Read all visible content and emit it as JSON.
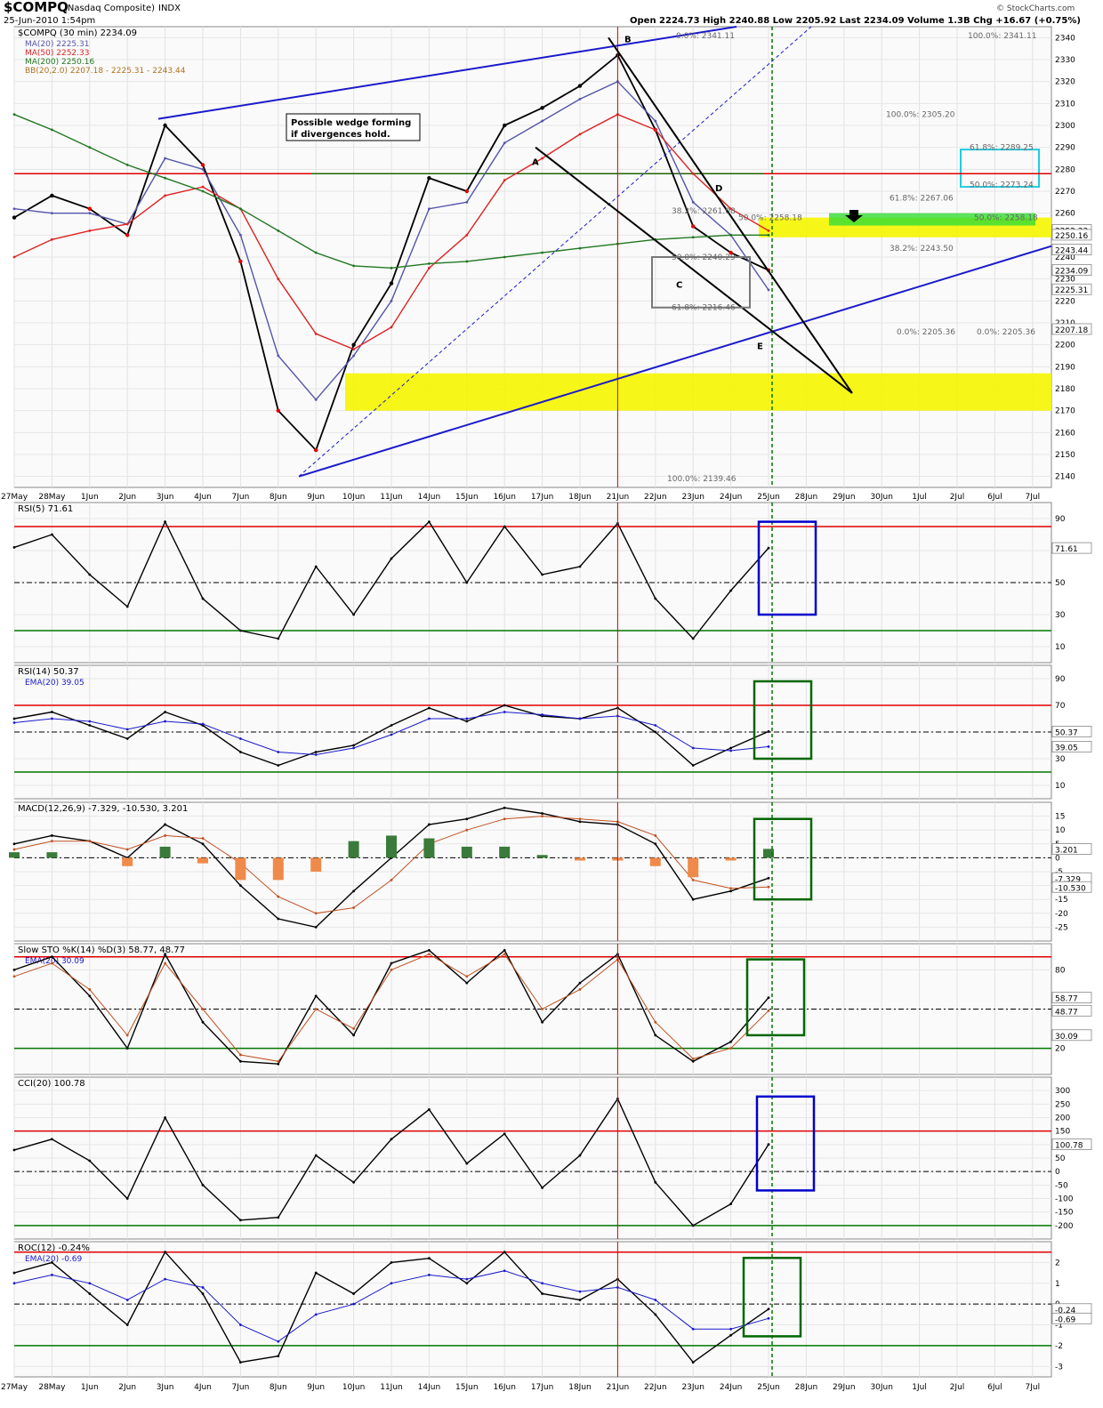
{
  "header": {
    "symbol": "$COMPQ",
    "name": "(Nasdaq Composite)",
    "exchange": "INDX",
    "date": "25-Jun-2010 1:54pm",
    "stats": "Open 2224.73  High 2240.88  Low 2205.92  Last 2234.09  Volume 1.3B  Chg +16.67 (+0.75%)",
    "brand": "© StockCharts.com"
  },
  "colors": {
    "price_up": "#000000",
    "price_down": "#e00000",
    "ma20": "#5555aa",
    "ma50": "#dd2222",
    "ma200": "#227722",
    "bb_fill": "#f3dfb8",
    "bb_line": "#c8a870",
    "rsi_over": "#3a7a3a",
    "rsi_under": "#f08a4a",
    "red_line": "#e00000",
    "green_line": "#007700",
    "blue_line": "#1a1acc",
    "yellow_zone": "#f5f500",
    "green_zone": "#33dd33",
    "cyan": "#22ccdd"
  },
  "x_axis_labels": [
    "27May",
    "28May",
    "1Jun",
    "2Jun",
    "3Jun",
    "4Jun",
    "7Jun",
    "8Jun",
    "9Jun",
    "10Jun",
    "11Jun",
    "14Jun",
    "15Jun",
    "16Jun",
    "17Jun",
    "18Jun",
    "21Jun",
    "22Jun",
    "23Jun",
    "24Jun",
    "25Jun",
    "28Jun",
    "29Jun",
    "30Jun",
    "1Jul",
    "2Jul",
    "6Jul",
    "7Jul"
  ],
  "chart_data": [
    {
      "type": "line",
      "panel": "price",
      "title": "$COMPQ (30 min) 2234.09",
      "legend": [
        "MA(20) 2225.31",
        "MA(50) 2252.33",
        "MA(200) 2250.16",
        "BB(20,2.0) 2207.18 - 2225.31 - 2243.44"
      ],
      "ylim": [
        2135,
        2345
      ],
      "yticks": [
        2140,
        2150,
        2160,
        2170,
        2180,
        2190,
        2200,
        2210,
        2220,
        2230,
        2240,
        2250,
        2260,
        2270,
        2280,
        2290,
        2300,
        2310,
        2320,
        2330,
        2340
      ],
      "value_boxes": [
        "2252.33",
        "2250.16",
        "2243.44",
        "2234.09",
        "2225.31",
        "2207.18"
      ],
      "x": [
        "27May",
        "28May",
        "1Jun",
        "2Jun",
        "3Jun",
        "4Jun",
        "7Jun",
        "8Jun",
        "9Jun",
        "10Jun",
        "11Jun",
        "14Jun",
        "15Jun",
        "16Jun",
        "17Jun",
        "18Jun",
        "21Jun",
        "22Jun",
        "23Jun",
        "24Jun",
        "25Jun"
      ],
      "series": [
        {
          "name": "$COMPQ",
          "values": [
            2258,
            2268,
            2262,
            2250,
            2300,
            2282,
            2238,
            2170,
            2152,
            2200,
            2228,
            2276,
            2270,
            2300,
            2308,
            2318,
            2332,
            2298,
            2254,
            2242,
            2234
          ]
        },
        {
          "name": "MA(20)",
          "values": [
            2262,
            2260,
            2260,
            2255,
            2285,
            2280,
            2250,
            2195,
            2175,
            2195,
            2220,
            2262,
            2265,
            2292,
            2302,
            2312,
            2320,
            2302,
            2265,
            2250,
            2225
          ]
        },
        {
          "name": "MA(50)",
          "values": [
            2240,
            2248,
            2252,
            2255,
            2268,
            2272,
            2262,
            2230,
            2205,
            2198,
            2208,
            2235,
            2250,
            2275,
            2285,
            2296,
            2305,
            2298,
            2278,
            2262,
            2252
          ]
        },
        {
          "name": "MA(200)",
          "values": [
            2305,
            2298,
            2290,
            2282,
            2276,
            2270,
            2262,
            2252,
            2242,
            2236,
            2235,
            2237,
            2238,
            2240,
            2242,
            2244,
            2246,
            2248,
            2249,
            2250,
            2250
          ]
        }
      ],
      "annotations": [
        "Possible wedge forming",
        "if divergences hold.",
        "A",
        "B",
        "C",
        "D",
        "E"
      ],
      "fib_labels": [
        "0.0%: 2341.11",
        "100.0%: 2341.11",
        "100.0%: 2305.20",
        "61.8%: 2289.25",
        "50.0%: 2273.24",
        "61.8%: 2267.06",
        "38.2%: 2261.08",
        "38.2%: 2243.50",
        "50.0%: 2240.29",
        "61.8%: 2216.46",
        "0.0%: 2205.36",
        "0.0%: 2205.36",
        "100.0%: 2139.46",
        "50.0%: 2258.18",
        "50.0%: 2258.18"
      ]
    },
    {
      "type": "line",
      "panel": "RSI(5)",
      "title": "RSI(5) 71.61",
      "ylim": [
        0,
        100
      ],
      "yticks": [
        10,
        30,
        50,
        70,
        90
      ],
      "value_boxes": [
        "71.61"
      ],
      "series": [
        {
          "name": "RSI(5)",
          "values": [
            72,
            80,
            55,
            35,
            88,
            40,
            20,
            15,
            60,
            30,
            65,
            88,
            50,
            85,
            55,
            60,
            87,
            40,
            15,
            45,
            71.61
          ]
        }
      ]
    },
    {
      "type": "line",
      "panel": "RSI(14)",
      "title": "RSI(14) 50.37",
      "legend": [
        "EMA(20) 39.05"
      ],
      "ylim": [
        0,
        100
      ],
      "yticks": [
        10,
        30,
        50,
        70,
        90
      ],
      "value_boxes": [
        "50.37",
        "39.05"
      ],
      "series": [
        {
          "name": "RSI(14)",
          "values": [
            60,
            65,
            55,
            45,
            65,
            55,
            35,
            25,
            35,
            40,
            55,
            68,
            58,
            70,
            62,
            60,
            68,
            50,
            25,
            38,
            50.37
          ]
        },
        {
          "name": "EMA(20)",
          "values": [
            57,
            60,
            58,
            52,
            58,
            56,
            45,
            35,
            33,
            38,
            48,
            60,
            60,
            65,
            63,
            60,
            62,
            55,
            38,
            36,
            39.05
          ]
        }
      ]
    },
    {
      "type": "line",
      "panel": "MACD",
      "title": "MACD(12,26,9) -7.329, -10.530, 3.201",
      "ylim": [
        -30,
        20
      ],
      "yticks": [
        -25,
        -20,
        -15,
        -10,
        -5,
        0,
        5,
        10,
        15
      ],
      "value_boxes": [
        "3.201",
        "-7.329",
        "-10.530"
      ],
      "series": [
        {
          "name": "MACD",
          "values": [
            5,
            8,
            6,
            0,
            12,
            5,
            -10,
            -22,
            -25,
            -12,
            0,
            12,
            14,
            18,
            16,
            13,
            12,
            5,
            -15,
            -12,
            -7.329
          ]
        },
        {
          "name": "Signal",
          "values": [
            3,
            6,
            6,
            3,
            8,
            7,
            -2,
            -14,
            -20,
            -18,
            -8,
            5,
            10,
            14,
            15,
            14,
            13,
            8,
            -8,
            -11,
            -10.53
          ]
        },
        {
          "name": "Histogram",
          "values": [
            2,
            2,
            0,
            -3,
            4,
            -2,
            -8,
            -8,
            -5,
            6,
            8,
            7,
            4,
            4,
            1,
            -1,
            -1,
            -3,
            -7,
            -1,
            3.201
          ]
        }
      ]
    },
    {
      "type": "line",
      "panel": "Slow STO",
      "title": "Slow STO %K(14) %D(3) 58.77, 48.77",
      "legend": [
        "EMA(20) 30.09"
      ],
      "ylim": [
        0,
        100
      ],
      "yticks": [
        20,
        50,
        80
      ],
      "value_boxes": [
        "58.77",
        "48.77",
        "30.09"
      ],
      "series": [
        {
          "name": "%K",
          "values": [
            80,
            90,
            60,
            20,
            92,
            40,
            10,
            8,
            60,
            30,
            85,
            95,
            70,
            95,
            40,
            70,
            92,
            30,
            10,
            25,
            58.77
          ]
        },
        {
          "name": "%D",
          "values": [
            75,
            85,
            65,
            30,
            85,
            50,
            15,
            10,
            50,
            35,
            80,
            92,
            75,
            92,
            50,
            65,
            88,
            40,
            12,
            20,
            48.77
          ]
        }
      ]
    },
    {
      "type": "line",
      "panel": "CCI(20)",
      "title": "CCI(20) 100.78",
      "ylim": [
        -250,
        350
      ],
      "yticks": [
        -200,
        -150,
        -100,
        -50,
        0,
        50,
        100,
        150,
        200,
        250,
        300
      ],
      "value_boxes": [
        "100.78"
      ],
      "series": [
        {
          "name": "CCI(20)",
          "values": [
            80,
            120,
            40,
            -100,
            200,
            -50,
            -180,
            -170,
            60,
            -40,
            120,
            230,
            30,
            140,
            -60,
            60,
            270,
            -40,
            -200,
            -120,
            100.78
          ]
        }
      ]
    },
    {
      "type": "line",
      "panel": "ROC(12)",
      "title": "ROC(12) -0.24%",
      "legend": [
        "EMA(20) -0.69"
      ],
      "ylim": [
        -3.5,
        3
      ],
      "yticks": [
        -3,
        -2,
        -1,
        0,
        1,
        2
      ],
      "value_boxes": [
        "-0.24",
        "-0.69"
      ],
      "series": [
        {
          "name": "ROC(12)",
          "values": [
            1.5,
            2.0,
            0.5,
            -1.0,
            2.5,
            0.5,
            -2.8,
            -2.5,
            1.5,
            0.5,
            2.0,
            2.2,
            1.0,
            2.5,
            0.5,
            0.2,
            1.2,
            -0.5,
            -2.8,
            -1.5,
            -0.24
          ]
        },
        {
          "name": "EMA(20)",
          "values": [
            1.0,
            1.4,
            1.0,
            0.2,
            1.2,
            0.8,
            -1.0,
            -1.8,
            -0.5,
            0.0,
            1.0,
            1.4,
            1.2,
            1.6,
            1.0,
            0.6,
            0.8,
            0.2,
            -1.2,
            -1.2,
            -0.69
          ]
        }
      ]
    }
  ]
}
